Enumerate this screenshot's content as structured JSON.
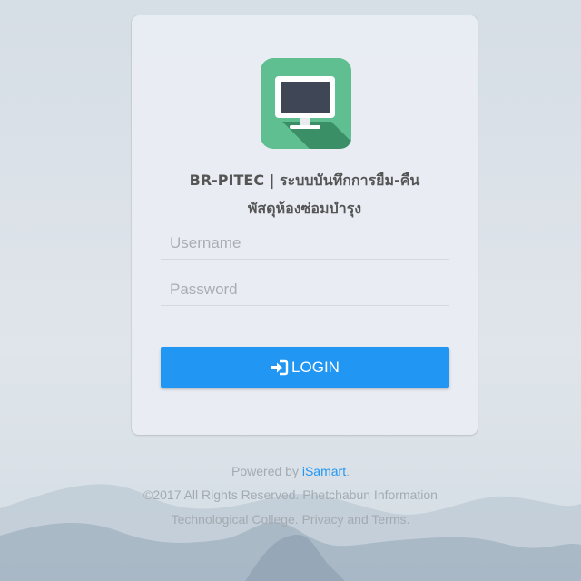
{
  "app": {
    "title_line1": "BR-PITEC | ระบบบันทึกการยืม-คืน",
    "title_line2": "พัสดุห้องซ่อมบำรุง",
    "logo_icon": "monitor-icon"
  },
  "form": {
    "username_placeholder": "Username",
    "password_placeholder": "Password",
    "login_label": "LOGIN",
    "login_icon": "sign-in-icon"
  },
  "footer": {
    "powered_prefix": "Powered by ",
    "powered_link": "iSamart",
    "powered_suffix": ".",
    "copyright_line1": "©2017 All Rights Reserved. Phetchabun Information",
    "copyright_line2": "Technological College.",
    "privacy_link": "Privacy and Terms"
  },
  "colors": {
    "accent": "#2196f3",
    "logo_green": "#5fbf91",
    "logo_dark_green": "#3a8f67",
    "background": "#dfe5ea"
  }
}
